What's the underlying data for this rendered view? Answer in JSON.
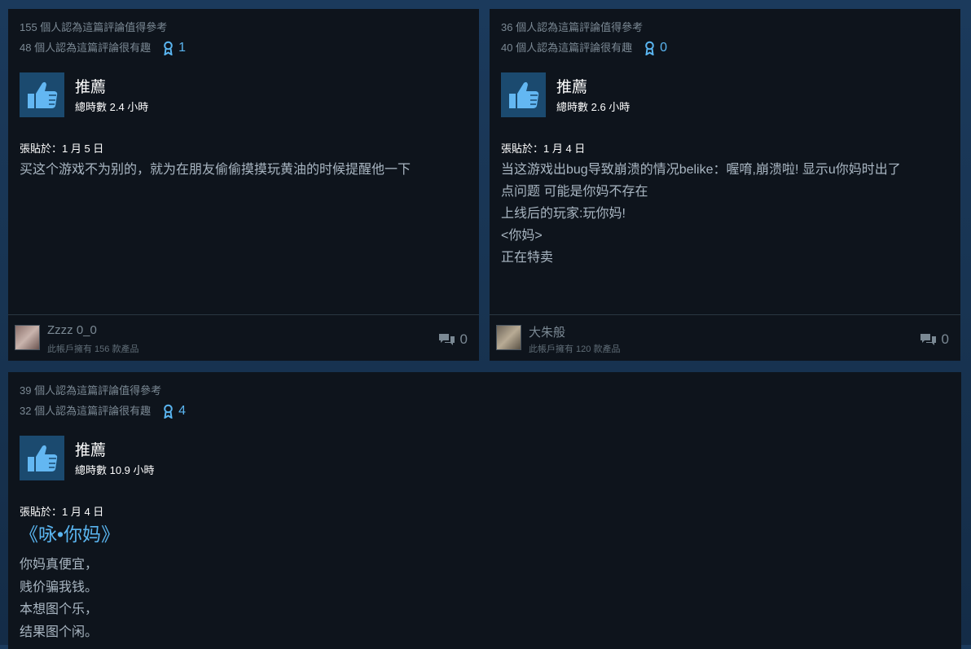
{
  "reviews": [
    {
      "helpful": "155 個人認為這篇評論值得參考",
      "funny": "48 個人認為這篇評論很有趣",
      "awards": "1",
      "rating": "推薦",
      "hours": "總時數 2.4 小時",
      "posted": "張貼於：1 月 5 日",
      "text": [
        "买这个游戏不为别的，就为在朋友偷偷摸摸玩黄油的时候提醒他一下"
      ],
      "author": "Zzzz 0_0",
      "owned": "此帳戶擁有 156 款產品",
      "comments": "0"
    },
    {
      "helpful": "36 個人認為這篇評論值得參考",
      "funny": "40 個人認為這篇評論很有趣",
      "awards": "0",
      "rating": "推薦",
      "hours": "總時數 2.6 小時",
      "posted": "張貼於：1 月 4 日",
      "text": [
        "当这游戏出bug导致崩溃的情况belike：喔唷,崩溃啦! 显示u你妈时出了",
        "点问题 可能是你妈不存在",
        "上线后的玩家:玩你妈!",
        "<你妈>",
        "正在特卖"
      ],
      "author": "大朱般",
      "owned": "此帳戶擁有 120 款產品",
      "comments": "0"
    },
    {
      "helpful": "39 個人認為這篇評論值得參考",
      "funny": "32 個人認為這篇評論很有趣",
      "awards": "4",
      "rating": "推薦",
      "hours": "總時數 10.9 小時",
      "posted": "張貼於：1 月 4 日",
      "heading": "《咏•你妈》",
      "text": [
        "你妈真便宜，",
        "贱价骗我钱。",
        "本想图个乐，",
        "结果图个闲。"
      ]
    }
  ],
  "colors": {
    "accent": "#5ab5f0",
    "card_bg": "#0e141c",
    "page_bg": "#1b3a5c"
  },
  "icons": {
    "award": "award-ribbon-icon",
    "thumb": "thumbs-up-icon",
    "comment": "comment-bubbles-icon"
  }
}
